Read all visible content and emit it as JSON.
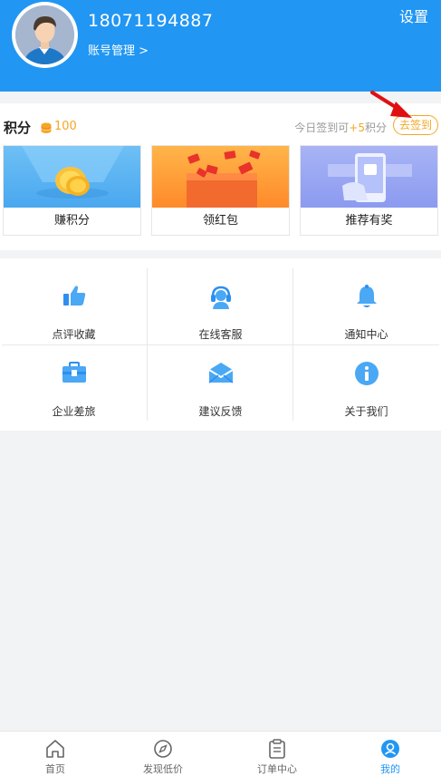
{
  "header": {
    "phone": "18071194887",
    "account_label": "账号管理 >",
    "settings_label": "设置"
  },
  "points": {
    "title": "积分",
    "value": "100",
    "hint_prefix": "今日签到可",
    "hint_bonus": "+5",
    "hint_suffix": "积分",
    "checkin_label": "去签到"
  },
  "cards": [
    {
      "label": "赚积分"
    },
    {
      "label": "领红包"
    },
    {
      "label": "推荐有奖"
    }
  ],
  "grid": [
    {
      "label": "点评收藏",
      "icon": "thumbs-up-icon"
    },
    {
      "label": "在线客服",
      "icon": "headset-icon"
    },
    {
      "label": "通知中心",
      "icon": "bell-icon"
    },
    {
      "label": "企业差旅",
      "icon": "briefcase-icon"
    },
    {
      "label": "建议反馈",
      "icon": "mail-icon"
    },
    {
      "label": "关于我们",
      "icon": "info-icon"
    }
  ],
  "tabs": [
    {
      "label": "首页",
      "icon": "home-icon"
    },
    {
      "label": "发现低价",
      "icon": "compass-icon"
    },
    {
      "label": "订单中心",
      "icon": "clipboard-icon"
    },
    {
      "label": "我的",
      "icon": "user-icon",
      "active": true
    }
  ],
  "colors": {
    "primary": "#2196f3",
    "accent": "#f5a623",
    "icon_blue": "#2d8ff0"
  }
}
